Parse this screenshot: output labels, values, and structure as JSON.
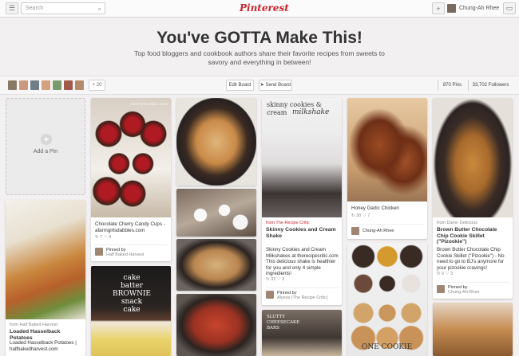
{
  "topbar": {
    "search_placeholder": "Search",
    "logo_text": "Pinterest",
    "user_name": "Chung-Ah Rhee"
  },
  "board": {
    "title": "You've GOTTA Make This!",
    "description": "Top food bloggers and cookbook authors share their favorite recipes from sweets to savory and everything in between!",
    "more_collaborators": "+ 20",
    "edit_label": "Edit Board",
    "send_label": "Send Board",
    "pins_count": "870 Pins",
    "followers_count": "33,702 Followers"
  },
  "add_pin_label": "Add a Pin",
  "pins": {
    "cherry": {
      "image_text": "cherryfourkid.com",
      "caption": "Chocolate Cherry Candy Cups - afarmgirlsdabbles.com",
      "stats": "↻ 7   ♡ 4",
      "pinned_by": "Pinned by",
      "pinner": "Half Baked Harvest"
    },
    "cookies_milk": {
      "overlay": "skinny cookies & cream",
      "overlay2": "milkshake",
      "source": "from The Recipe Critic",
      "title": "Skinny Cookies and Cream Shake",
      "caption": "Skinny Cookies and Cream Milkshakes at therecipecritic.com This delicious shake is healthier for you and only 4 simple ingredients!",
      "stats": "↻ 33   ♡ 2",
      "pinned_by": "Pinned by",
      "pinner": "Alyssa (The Recipe Critic)"
    },
    "honey_chicken": {
      "caption": "Honey Garlic Chicken",
      "stats": "↻ 30   ♡ 7",
      "pinner": "Chung-Ah Rhee"
    },
    "pizookie": {
      "source": "from Damn Delicious",
      "title": "Brown Butter Chocolate Chip Cookie Skillet (\"Pizookie\")",
      "caption": "Brown Butter Chocolate Chip Cookie Skillet (\"Pizookie\") - No need to go to BJ's anymore for your pizookie cravings!",
      "stats": "↻ 6   ♡ 3",
      "pinned_by": "Pinned by",
      "pinner": "Chung-Ah Rhee"
    },
    "hasselback": {
      "source": "from Half Baked Harvest",
      "title": "Loaded Hasselback Potatoes",
      "caption": "Loaded Hasselback Potatoes | halfbakedharvest.com"
    },
    "brownie": {
      "overlay": "cake batter BROWNIE snack cake"
    },
    "cheesecake": {
      "overlay": "SLUTTY CHEESECAKE BARS"
    },
    "one_cookie": {
      "overlay": "ONE COOKIE"
    }
  },
  "colors": {
    "brand": "#c8232c",
    "background": "#f2f0f0"
  }
}
